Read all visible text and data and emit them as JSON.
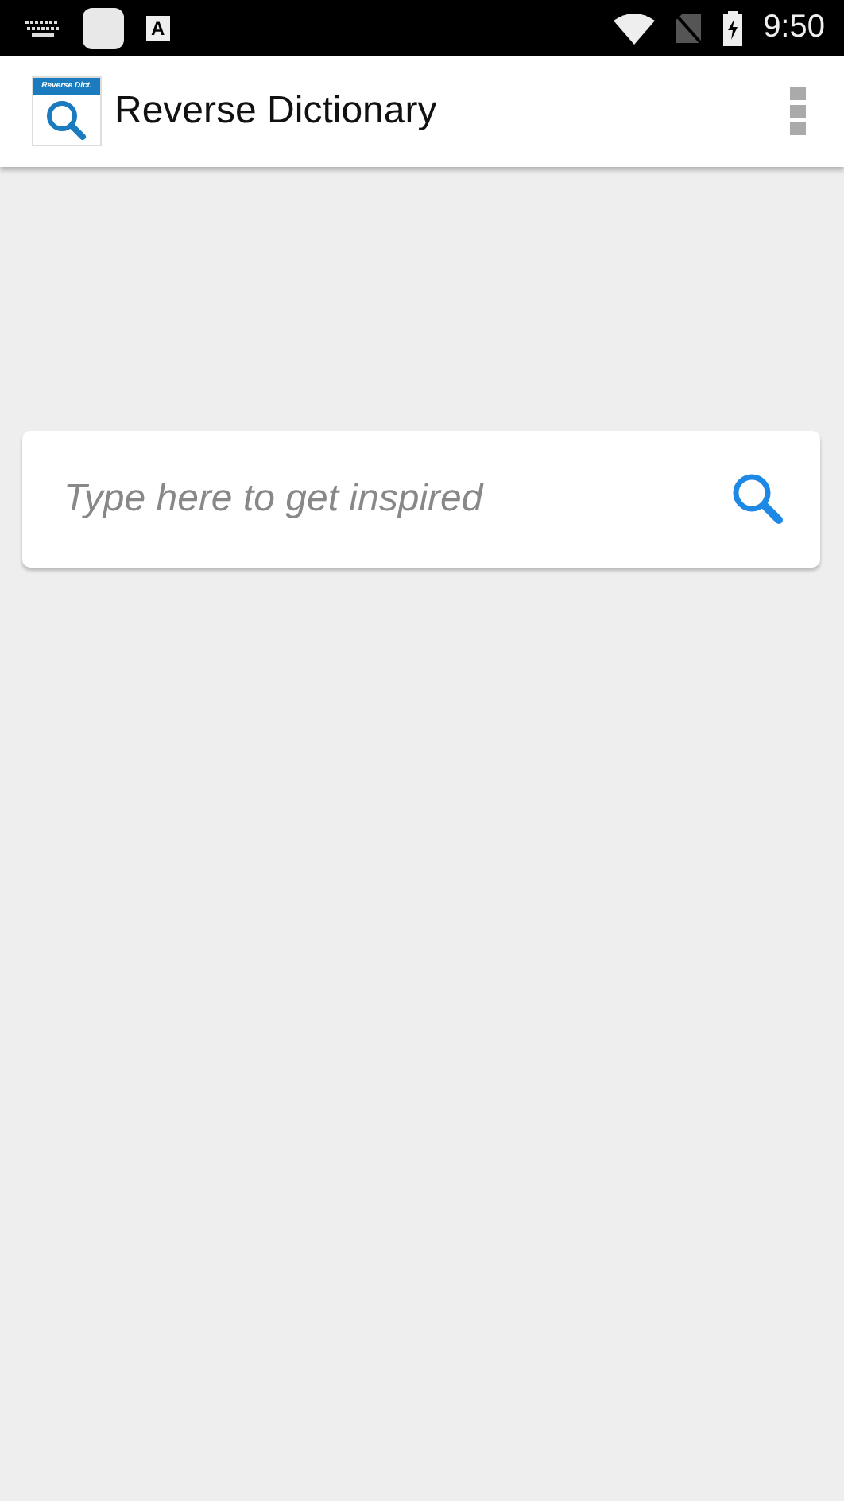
{
  "status_bar": {
    "time": "9:50",
    "app_badge": "A"
  },
  "app_bar": {
    "logo_text": "Reverse Dict.",
    "title": "Reverse Dictionary"
  },
  "search": {
    "placeholder": "Type here to get inspired"
  }
}
